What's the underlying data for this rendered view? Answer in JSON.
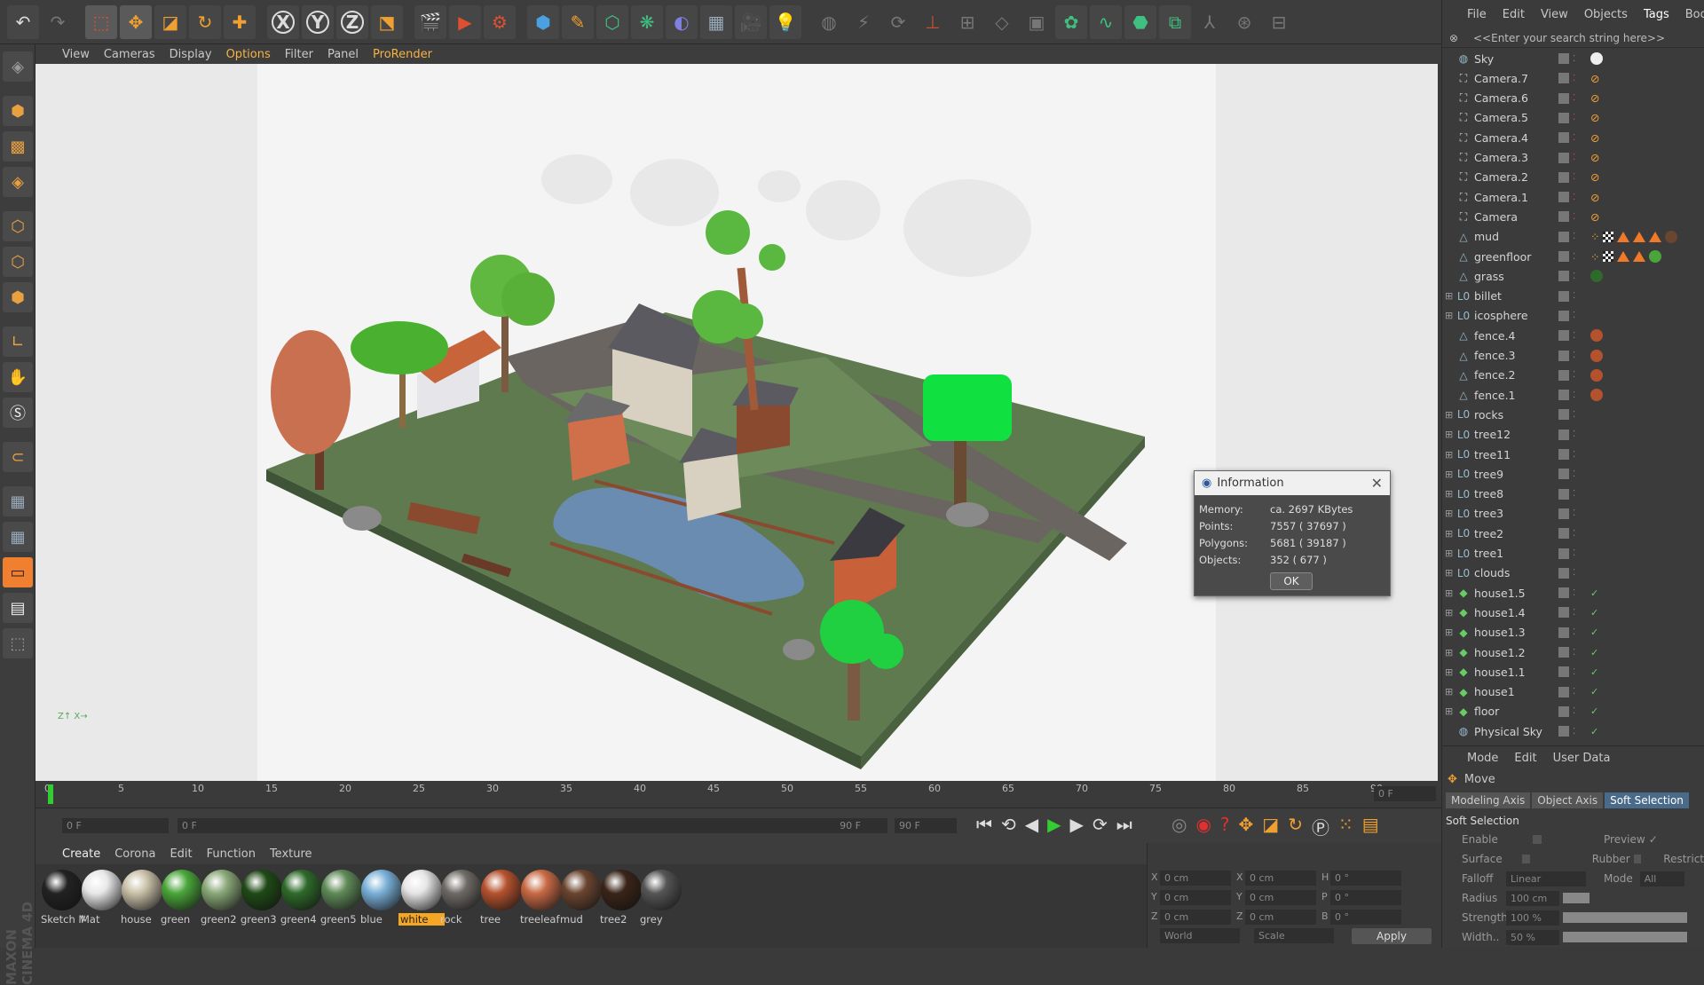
{
  "toolbar": {
    "icons": [
      "undo-icon",
      "redo-icon",
      "live-select-icon",
      "move-icon",
      "scale-icon",
      "rotate-icon",
      "recent-tool-icon",
      "x-axis-icon",
      "y-axis-icon",
      "z-axis-icon",
      "world-coord-icon",
      "render-view-icon",
      "render-picture-queue-icon",
      "render-settings-icon",
      "cube-icon",
      "pen-icon",
      "subdivision-icon",
      "cloner-icon",
      "deformer-icon",
      "floor-icon",
      "camera-icon",
      "light-icon"
    ],
    "x_label": "X",
    "y_label": "Y",
    "z_label": "Z"
  },
  "viewport_menu": [
    "View",
    "Cameras",
    "Display",
    "Options",
    "Filter",
    "Panel",
    "ProRender"
  ],
  "viewport_menu_highlight": [
    "Options",
    "ProRender"
  ],
  "object_menu": [
    "File",
    "Edit",
    "View",
    "Objects",
    "Tags",
    "Bookmarks"
  ],
  "object_menu_highlight": "Tags",
  "search_placeholder": "<<Enter your search string here>>",
  "objects": [
    {
      "name": "Sky",
      "icon": "sky-icon",
      "tags": [
        "white-ball"
      ]
    },
    {
      "name": "Camera.7",
      "icon": "camera-icon",
      "tags": [
        "no-render"
      ]
    },
    {
      "name": "Camera.6",
      "icon": "camera-icon",
      "tags": [
        "no-render"
      ]
    },
    {
      "name": "Camera.5",
      "icon": "camera-icon",
      "tags": [
        "no-render"
      ]
    },
    {
      "name": "Camera.4",
      "icon": "camera-icon",
      "tags": [
        "no-render"
      ]
    },
    {
      "name": "Camera.3",
      "icon": "camera-icon",
      "tags": [
        "no-render"
      ]
    },
    {
      "name": "Camera.2",
      "icon": "camera-icon",
      "tags": [
        "no-render"
      ]
    },
    {
      "name": "Camera.1",
      "icon": "camera-icon",
      "tags": [
        "no-render"
      ]
    },
    {
      "name": "Camera",
      "icon": "camera-icon",
      "tags": [
        "no-render"
      ]
    },
    {
      "name": "mud",
      "icon": "polygon-icon",
      "tags": [
        "dots",
        "checker",
        "tri",
        "tri",
        "tri",
        "brown-ball"
      ]
    },
    {
      "name": "greenfloor",
      "icon": "polygon-icon",
      "tags": [
        "dots",
        "checker",
        "tri",
        "tri",
        "green-ball"
      ]
    },
    {
      "name": "grass",
      "icon": "polygon-icon",
      "tags": [
        "darkgreen-ball"
      ]
    },
    {
      "name": "billet",
      "icon": "null-icon",
      "expand": true,
      "tags": []
    },
    {
      "name": "icosphere",
      "icon": "null-icon",
      "expand": true,
      "tags": []
    },
    {
      "name": "fence.4",
      "icon": "polygon-icon",
      "tags": [
        "rust-ball"
      ]
    },
    {
      "name": "fence.3",
      "icon": "polygon-icon",
      "tags": [
        "rust-ball"
      ]
    },
    {
      "name": "fence.2",
      "icon": "polygon-icon",
      "tags": [
        "rust-ball"
      ]
    },
    {
      "name": "fence.1",
      "icon": "polygon-icon",
      "tags": [
        "rust-ball"
      ]
    },
    {
      "name": "rocks",
      "icon": "null-icon",
      "expand": true,
      "tags": []
    },
    {
      "name": "tree12",
      "icon": "null-icon",
      "expand": true,
      "tags": []
    },
    {
      "name": "tree11",
      "icon": "null-icon",
      "expand": true,
      "tags": []
    },
    {
      "name": "tree9",
      "icon": "null-icon",
      "expand": true,
      "tags": []
    },
    {
      "name": "tree8",
      "icon": "null-icon",
      "expand": true,
      "tags": []
    },
    {
      "name": "tree3",
      "icon": "null-icon",
      "expand": true,
      "tags": []
    },
    {
      "name": "tree2",
      "icon": "null-icon",
      "expand": true,
      "tags": []
    },
    {
      "name": "tree1",
      "icon": "null-icon",
      "expand": true,
      "tags": []
    },
    {
      "name": "clouds",
      "icon": "null-icon",
      "expand": true,
      "tags": []
    },
    {
      "name": "house1.5",
      "icon": "house-icon",
      "expand": true,
      "tags": [
        "check"
      ]
    },
    {
      "name": "house1.4",
      "icon": "house-icon",
      "expand": true,
      "tags": [
        "check"
      ]
    },
    {
      "name": "house1.3",
      "icon": "house-icon",
      "expand": true,
      "tags": [
        "check"
      ]
    },
    {
      "name": "house1.2",
      "icon": "house-icon",
      "expand": true,
      "tags": [
        "check"
      ]
    },
    {
      "name": "house1.1",
      "icon": "house-icon",
      "expand": true,
      "tags": [
        "check"
      ]
    },
    {
      "name": "house1",
      "icon": "house-icon",
      "expand": true,
      "tags": [
        "check"
      ]
    },
    {
      "name": "floor",
      "icon": "house-icon",
      "expand": true,
      "tags": [
        "check"
      ]
    },
    {
      "name": "Physical Sky",
      "icon": "sky-icon",
      "tags": [
        "check"
      ]
    }
  ],
  "info_dialog": {
    "title": "Information",
    "rows": [
      {
        "k": "Memory:",
        "v": "ca. 2697 KBytes"
      },
      {
        "k": "Points:",
        "v": "7557 ( 37697 )"
      },
      {
        "k": "Polygons:",
        "v": "5681 ( 39187 )"
      },
      {
        "k": "Objects:",
        "v": "352 ( 677 )"
      }
    ],
    "ok": "OK"
  },
  "timeline": {
    "ticks": [
      "0",
      "5",
      "10",
      "15",
      "20",
      "25",
      "30",
      "35",
      "40",
      "45",
      "50",
      "55",
      "60",
      "65",
      "70",
      "75",
      "80",
      "85",
      "90"
    ],
    "frame_field": "0 F"
  },
  "transport": {
    "start": "0 F",
    "range_start": "0 F",
    "range_end": "90 F",
    "end": "90 F"
  },
  "material_menu": [
    "Create",
    "Corona",
    "Edit",
    "Function",
    "Texture"
  ],
  "materials": [
    {
      "name": "Sketch M",
      "color": "#222",
      "ring": "#ddd"
    },
    {
      "name": "Mat",
      "color": "#e8e8e8"
    },
    {
      "name": "house",
      "color": "#c9c0a8"
    },
    {
      "name": "green",
      "color": "#4aa63a"
    },
    {
      "name": "green2",
      "color": "#8aa878"
    },
    {
      "name": "green3",
      "color": "#1f4a16"
    },
    {
      "name": "green4",
      "color": "#2e6a2a"
    },
    {
      "name": "green5",
      "color": "#5f8a58"
    },
    {
      "name": "blue",
      "color": "#7ab0d8"
    },
    {
      "name": "white",
      "color": "#e5e5e5",
      "selected": true
    },
    {
      "name": "rock",
      "color": "#6e6a66"
    },
    {
      "name": "tree",
      "color": "#b5522e"
    },
    {
      "name": "treeleaf",
      "color": "#c86a45"
    },
    {
      "name": "mud",
      "color": "#6a4530"
    },
    {
      "name": "tree2",
      "color": "#3a2418"
    },
    {
      "name": "grey",
      "color": "#555"
    }
  ],
  "coords": {
    "rows": [
      {
        "a": "X",
        "v1": "0 cm",
        "b": "X",
        "v2": "0 cm",
        "c": "H",
        "v3": "0 °"
      },
      {
        "a": "Y",
        "v1": "0 cm",
        "b": "Y",
        "v2": "0 cm",
        "c": "P",
        "v3": "0 °"
      },
      {
        "a": "Z",
        "v1": "0 cm",
        "b": "Z",
        "v2": "0 cm",
        "c": "B",
        "v3": "0 °"
      }
    ],
    "mode": "World",
    "scale": "Scale",
    "apply": "Apply"
  },
  "attributes": {
    "menu": [
      "Mode",
      "Edit",
      "User Data"
    ],
    "tool": "Move",
    "tabs": [
      "Modeling Axis",
      "Object Axis",
      "Soft Selection"
    ],
    "active_tab": "Soft Selection",
    "section": "Soft Selection",
    "enable": "Enable",
    "preview": "Preview",
    "surface": "Surface",
    "rubber": "Rubber",
    "restrict": "Restrict",
    "falloff": "Falloff",
    "falloff_val": "Linear",
    "mode": "Mode",
    "mode_val": "All",
    "radius": "Radius",
    "radius_val": "100 cm",
    "strength": "Strength",
    "strength_val": "100 %",
    "width": "Width..",
    "width_val": "50 %"
  },
  "brand": "MAXON CINEMA 4D",
  "colors": {
    "accent": "#f5a623",
    "ground": "#5f7a4e",
    "road": "#6b6562",
    "water": "#6a8cb0"
  }
}
